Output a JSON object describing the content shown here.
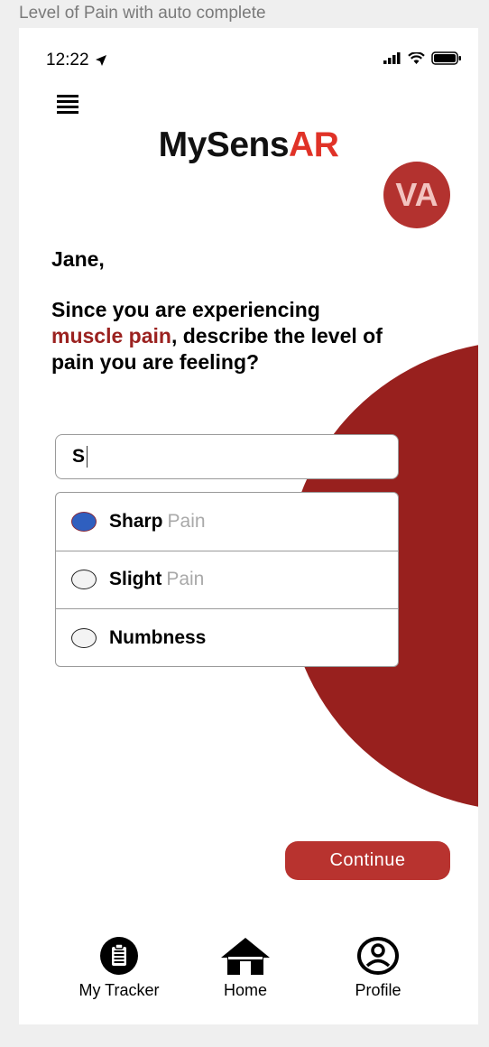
{
  "frame": {
    "title": "Level of Pain with auto complete"
  },
  "status_bar": {
    "time": "12:22",
    "icons": [
      "location-arrow-icon",
      "signal-icon",
      "wifi-icon",
      "battery-icon"
    ]
  },
  "header": {
    "logo_part1": "MySens",
    "logo_part2": "AR",
    "avatar_initials": "VA"
  },
  "prompt": {
    "greeting": "Jane,",
    "line_intro": "Since you are experiencing",
    "highlight": "muscle pain",
    "line_rest": ", describe the level of pain you are feeling?"
  },
  "search": {
    "value": "S"
  },
  "options": [
    {
      "bold": "Sharp",
      "rest": "Pain",
      "selected": true
    },
    {
      "bold": "Slight",
      "rest": "Pain",
      "selected": false
    },
    {
      "bold": "Numbness",
      "rest": "",
      "selected": false
    }
  ],
  "continue_label": "Continue",
  "nav": {
    "tracker": "My Tracker",
    "home": "Home",
    "profile": "Profile"
  },
  "colors": {
    "brand_red": "#98201e",
    "accent_red": "#e03227",
    "button_red": "#b8332f",
    "selected_blue": "#2f5fbf"
  }
}
